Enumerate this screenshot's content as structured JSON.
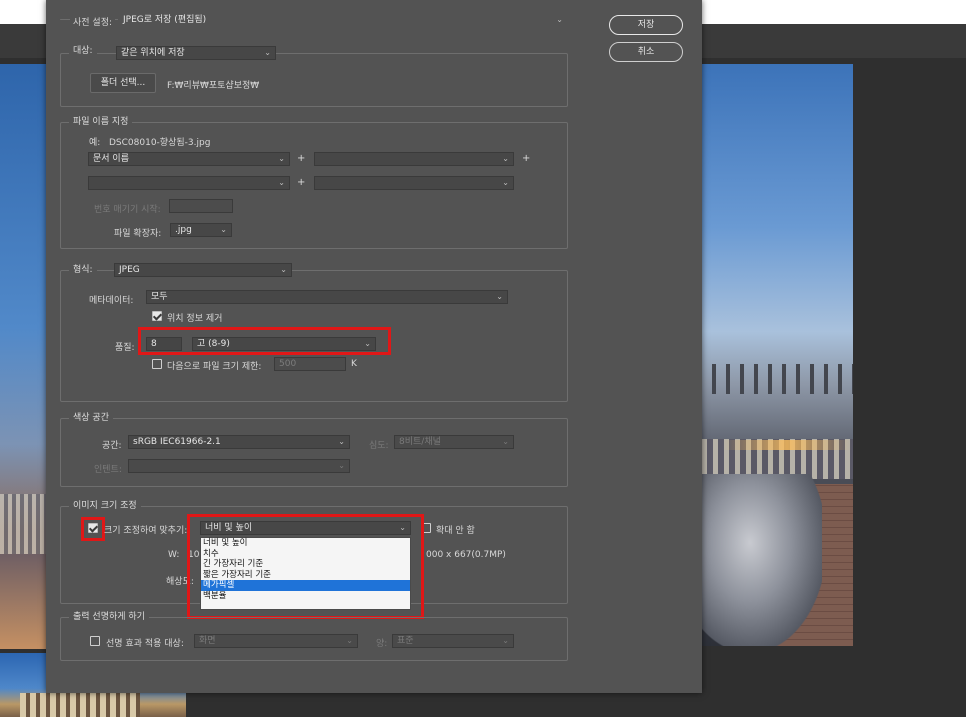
{
  "dialog": {
    "preset_label": "사전 설정:",
    "preset_value": "JPEG로 저장 (편집됨)",
    "save_button": "저장",
    "cancel_button": "취소"
  },
  "destination": {
    "legend_label": "대상:",
    "location_value": "같은 위치에 저장",
    "select_folder_button": "폴더 선택...",
    "folder_path": "F:₩리뷰₩포토샵보정₩"
  },
  "file_naming": {
    "legend": "파일 이름 지정",
    "example_label": "예:",
    "example_value": "DSC08010-향상됨-3.jpg",
    "part1_value": "문서 이름",
    "part2_value": "",
    "part3_value": "",
    "part4_value": "",
    "plus": "+",
    "start_number_label": "번호 매기기 시작:",
    "start_number_value": "",
    "extension_label": "파일 확장자:",
    "extension_value": ".jpg"
  },
  "format": {
    "legend_label": "형식:",
    "format_value": "JPEG",
    "metadata_label": "메타데이터:",
    "metadata_value": "모두",
    "remove_location_label": "위치 정보 제거",
    "quality_label": "품질:",
    "quality_value": "8",
    "quality_preset": "고 (8-9)",
    "limit_size_label": "다음으로 파일 크기 제한:",
    "limit_size_value": "500",
    "limit_size_unit": "K"
  },
  "color_space": {
    "legend": "색상 공간",
    "space_label": "공간:",
    "space_value": "sRGB IEC61966-2.1",
    "depth_label": "심도:",
    "depth_value": "8비트/채널",
    "intent_label": "인텐트:",
    "intent_value": ""
  },
  "image_sizing": {
    "legend": "이미지 크기 조정",
    "resize_label": "크기 조정하여 맞추기:",
    "resize_value": "너비 및 높이",
    "no_enlarge_label": "확대 안 함",
    "w_label": "W:",
    "w_value_visible": "10",
    "size_info": "000 x 667(0.7MP)",
    "resolution_label": "해상도:",
    "dropdown_options": [
      "너비 및 높이",
      "치수",
      "긴 가장자리 기준",
      "짧은 가장자리 기준",
      "메가픽셀",
      "백분율"
    ],
    "selected_option_index": 4
  },
  "output_sharpening": {
    "legend": "출력 선명하게 하기",
    "sharpen_label": "선명 효과 적용 대상:",
    "sharpen_value": "화면",
    "amount_label": "양:",
    "amount_value": "표준"
  },
  "colors": {
    "dialog_bg": "#535353",
    "highlight_red": "#e01717",
    "selection_blue": "#1f73d8"
  }
}
